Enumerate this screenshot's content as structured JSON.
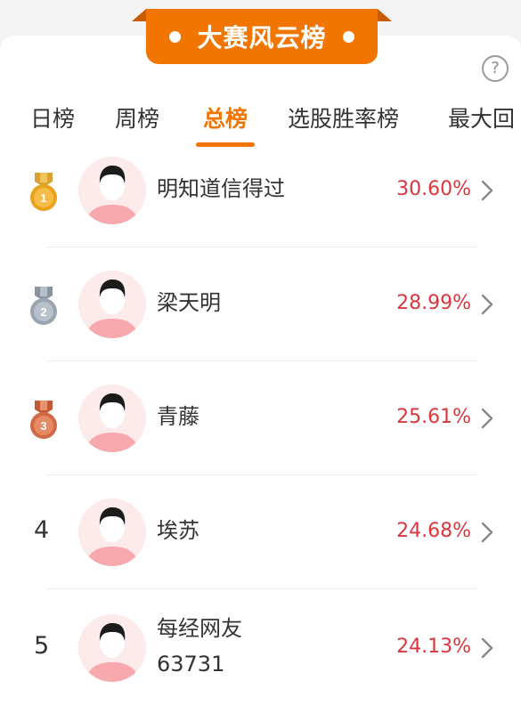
{
  "header": {
    "title": "大赛风云榜"
  },
  "tabs": [
    {
      "label": "日榜",
      "active": false
    },
    {
      "label": "周榜",
      "active": false
    },
    {
      "label": "总榜",
      "active": true
    },
    {
      "label": "选股胜率榜",
      "active": false
    },
    {
      "label": "最大回",
      "active": false
    }
  ],
  "help_icon": "question-circle-icon",
  "rows": [
    {
      "rank": "1",
      "medal": "gold",
      "name_line1": "明知道信得过",
      "name_line2": "",
      "value": "30.60%"
    },
    {
      "rank": "2",
      "medal": "silver",
      "name_line1": "梁天明",
      "name_line2": "",
      "value": "28.99%"
    },
    {
      "rank": "3",
      "medal": "bronze",
      "name_line1": "青藤",
      "name_line2": "",
      "value": "25.61%"
    },
    {
      "rank": "4",
      "medal": "",
      "name_line1": "埃苏",
      "name_line2": "",
      "value": "24.68%"
    },
    {
      "rank": "5",
      "medal": "",
      "name_line1": "每经网友",
      "name_line2": "63731",
      "value": "24.13%"
    }
  ],
  "colors": {
    "accent": "#f27500",
    "value_red": "#d9363e",
    "gold": "#e8a21c",
    "silver": "#9aa4b0",
    "bronze": "#d06a44"
  }
}
